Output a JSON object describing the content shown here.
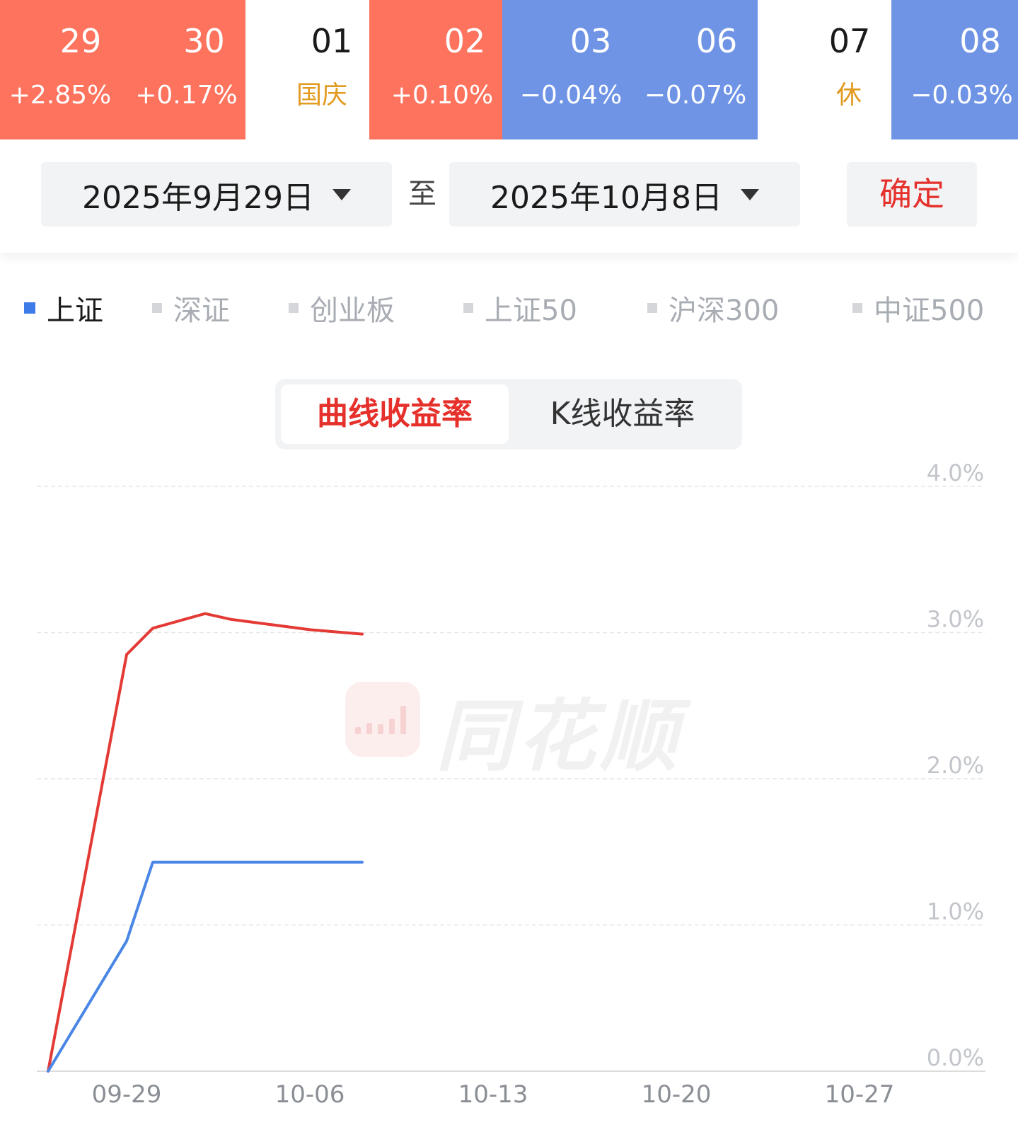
{
  "calendar": {
    "days": [
      {
        "day": "29",
        "sub": "+2.85%",
        "status": "up"
      },
      {
        "day": "30",
        "sub": "+0.17%",
        "status": "up"
      },
      {
        "day": "01",
        "sub": "国庆",
        "status": "holiday"
      },
      {
        "day": "02",
        "sub": "+0.10%",
        "status": "up"
      },
      {
        "day": "03",
        "sub": "−0.04%",
        "status": "down"
      },
      {
        "day": "06",
        "sub": "−0.07%",
        "status": "down"
      },
      {
        "day": "07",
        "sub": "休",
        "status": "rest"
      },
      {
        "day": "08",
        "sub": "−0.03%",
        "status": "down"
      }
    ],
    "colors": {
      "up": "#fd735e",
      "down": "#6f94e6",
      "holiday_text": "#e29a1f"
    }
  },
  "range": {
    "start": "2025年9月29日",
    "to_label": "至",
    "end": "2025年10月8日",
    "confirm_label": "确定"
  },
  "indices": {
    "items": [
      "上证",
      "深证",
      "创业板",
      "上证50",
      "沪深300",
      "中证500"
    ],
    "selected": "上证"
  },
  "toggle": {
    "options": [
      "曲线收益率",
      "K线收益率"
    ],
    "selected": "曲线收益率"
  },
  "watermark": {
    "text": "同花顺"
  },
  "chart_data": {
    "type": "line",
    "x_ticks": [
      "09-29",
      "10-06",
      "10-13",
      "10-20",
      "10-27"
    ],
    "y_ticks": [
      "0.0%",
      "1.0%",
      "2.0%",
      "3.0%",
      "4.0%"
    ],
    "ylim": [
      0,
      4
    ],
    "grid": true,
    "series": [
      {
        "color": "#e33a35",
        "points": [
          {
            "x": "2025-09-26",
            "y": 0.0
          },
          {
            "x": "2025-09-29",
            "y": 2.85
          },
          {
            "x": "2025-09-30",
            "y": 3.03
          },
          {
            "x": "2025-10-02",
            "y": 3.13
          },
          {
            "x": "2025-10-03",
            "y": 3.09
          },
          {
            "x": "2025-10-06",
            "y": 3.02
          },
          {
            "x": "2025-10-08",
            "y": 2.99
          }
        ]
      },
      {
        "color": "#4a86e6",
        "points": [
          {
            "x": "2025-09-26",
            "y": 0.0
          },
          {
            "x": "2025-09-29",
            "y": 0.89
          },
          {
            "x": "2025-09-30",
            "y": 1.43
          },
          {
            "x": "2025-10-08",
            "y": 1.43
          }
        ]
      }
    ]
  }
}
